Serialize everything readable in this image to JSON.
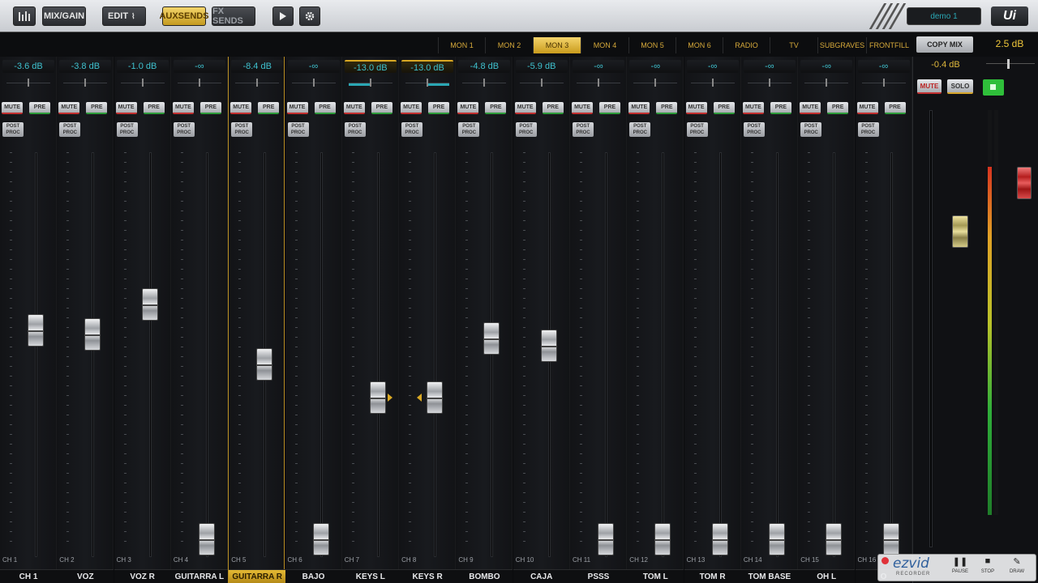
{
  "toolbar": {
    "buttons": [
      "MIX/GAIN",
      "EDIT",
      "AUXSENDS",
      "FX SENDS"
    ],
    "snapshot": "demo 1",
    "logo": "Ui"
  },
  "aux_tabs": [
    "MON 1",
    "MON 2",
    "MON 3",
    "MON 4",
    "MON 5",
    "MON 6",
    "RADIO",
    "TV",
    "SUBGRAVES",
    "FRONTFILL"
  ],
  "active_aux": "MON 3",
  "copy_mix": "COPY MIX",
  "master": {
    "top_db": "2.5 dB",
    "db": "-0.4 dB",
    "mute": "MUTE",
    "solo": "SOLO",
    "fader_level": 0.74,
    "meter_left_level": 0.86,
    "meter_right_level": 0.0,
    "main_fader_level": 0.86
  },
  "labels": {
    "mute": "MUTE",
    "pre": "PRE",
    "post": "POST",
    "proc": "PROC"
  },
  "channels": [
    {
      "num": "CH 1",
      "name": "CH 1",
      "db": "-3.6 dB",
      "level": 0.56
    },
    {
      "num": "CH 2",
      "name": "VOZ",
      "db": "-3.8 dB",
      "level": 0.55
    },
    {
      "num": "CH 3",
      "name": "VOZ R",
      "db": "-1.0 dB",
      "level": 0.63
    },
    {
      "num": "CH 4",
      "name": "GUITARRA L",
      "db": "-∞",
      "level": 0.0
    },
    {
      "num": "CH 5",
      "name": "GUITARRA R",
      "db": "-8.4 dB",
      "level": 0.47
    },
    {
      "num": "CH 6",
      "name": "BAJO",
      "db": "-∞",
      "level": 0.0
    },
    {
      "num": "CH 7",
      "name": "KEYS L",
      "db": "-13.0 dB",
      "level": 0.38
    },
    {
      "num": "CH 8",
      "name": "KEYS R",
      "db": "-13.0 dB",
      "level": 0.38
    },
    {
      "num": "CH 9",
      "name": "BOMBO",
      "db": "-4.8 dB",
      "level": 0.54
    },
    {
      "num": "CH 10",
      "name": "CAJA",
      "db": "-5.9 dB",
      "level": 0.52
    },
    {
      "num": "CH 11",
      "name": "PSSS",
      "db": "-∞",
      "level": 0.0
    },
    {
      "num": "CH 12",
      "name": "TOM L",
      "db": "-∞",
      "level": 0.0
    },
    {
      "num": "CH 13",
      "name": "TOM R",
      "db": "-∞",
      "level": 0.0
    },
    {
      "num": "CH 14",
      "name": "TOM BASE",
      "db": "-∞",
      "level": 0.0
    },
    {
      "num": "CH 15",
      "name": "OH L",
      "db": "-∞",
      "level": 0.0
    },
    {
      "num": "CH 16",
      "name": "O",
      "db": "-∞",
      "level": 0.0
    }
  ],
  "selected_channel": 4,
  "highlighted_db": [
    6,
    7
  ],
  "recorder": {
    "logo": "ezvid",
    "sub": "RECORDER",
    "pause": "PAUSE",
    "stop": "STOP",
    "draw": "DRAW"
  }
}
